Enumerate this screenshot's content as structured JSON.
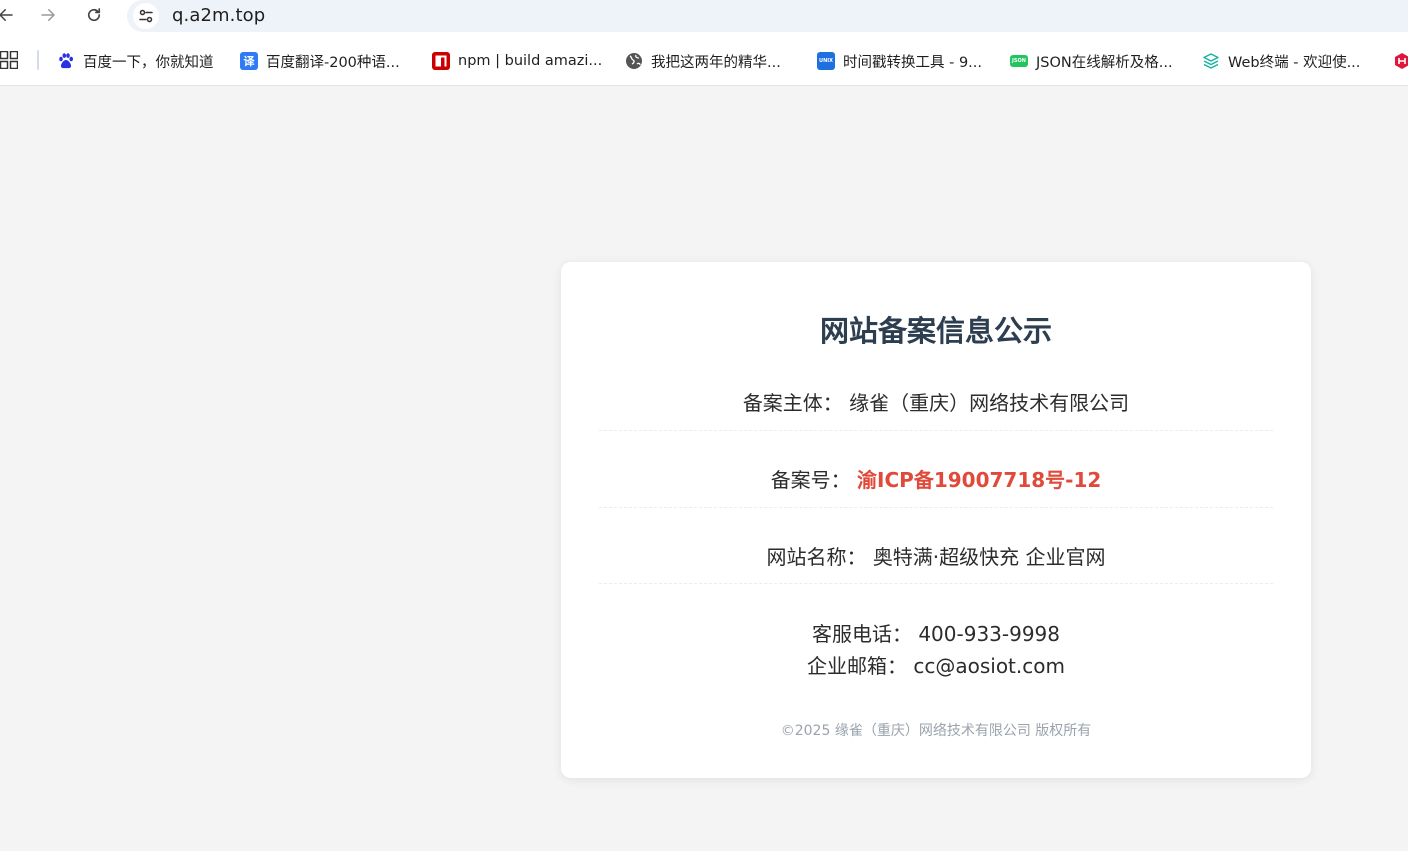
{
  "browser": {
    "url": "q.a2m.top",
    "bookmarks": [
      {
        "label": "百度一下，你就知道",
        "icon": "baidu-paw-icon",
        "color": "#2932e1"
      },
      {
        "label": "百度翻译-200种语...",
        "icon": "translate-icon",
        "glyph": "译",
        "color": "#2f7bf6"
      },
      {
        "label": "npm | build amazi...",
        "icon": "npm-icon",
        "color": "#cb0000"
      },
      {
        "label": "我把这两年的精华...",
        "icon": "globe-icon",
        "color": "#555555"
      },
      {
        "label": "时间戳转换工具 - 9...",
        "icon": "unix-icon",
        "glyph": "UNIX",
        "color": "#1e6fe0"
      },
      {
        "label": "JSON在线解析及格...",
        "icon": "json-icon",
        "glyph": "JSON",
        "color": "#22c55e"
      },
      {
        "label": "Web终端 - 欢迎使...",
        "icon": "layers-icon",
        "color": "#16b3a0"
      }
    ]
  },
  "record": {
    "title": "网站备案信息公示",
    "entity_label": "备案主体：",
    "entity_value": "缘雀（重庆）网络技术有限公司",
    "icp_label": "备案号：",
    "icp_value": "渝ICP备19007718号-12",
    "site_name_label": "网站名称：",
    "site_name_value": "奥特满·超级快充 企业官网",
    "phone_label": "客服电话：",
    "phone_value": "400-933-9998",
    "email_label": "企业邮箱：",
    "email_value": "cc@aosiot.com",
    "copyright": "©2025 缘雀（重庆）网络技术有限公司 版权所有"
  },
  "colors": {
    "title": "#2c3e50",
    "icp_highlight": "#e04a3a",
    "footer": "#9aa3ad"
  }
}
